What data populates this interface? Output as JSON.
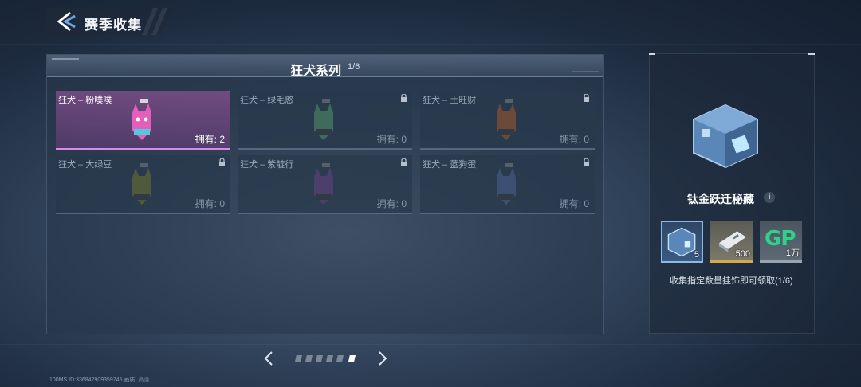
{
  "header": {
    "title": "赛季收集"
  },
  "collection": {
    "title": "狂犬系列",
    "count": "1/6",
    "items": [
      {
        "name": "狂犬 – 粉噗噗",
        "owned": "拥有: 2",
        "locked": false,
        "color": "#e35fb9"
      },
      {
        "name": "狂犬 – 绿毛憨",
        "owned": "拥有: 0",
        "locked": true,
        "color": "#3f6b5d"
      },
      {
        "name": "狂犬 – 土旺财",
        "owned": "拥有: 0",
        "locked": true,
        "color": "#6b4a3a"
      },
      {
        "name": "狂犬 – 大绿豆",
        "owned": "拥有: 0",
        "locked": true,
        "color": "#4f5a3d"
      },
      {
        "name": "狂犬 – 紫靛行",
        "owned": "拥有: 0",
        "locked": true,
        "color": "#4c3f6b"
      },
      {
        "name": "狂犬 – 蓝狗蛋",
        "owned": "拥有: 0",
        "locked": true,
        "color": "#3d4f72"
      }
    ]
  },
  "pagination": {
    "total": 6,
    "current": 6
  },
  "reward": {
    "title": "钛金跃迁秘藏",
    "info_icon": "i",
    "items": [
      {
        "icon": "chest-icon",
        "qty": "5"
      },
      {
        "icon": "ticket-icon",
        "qty": "500"
      },
      {
        "icon": "gp-icon",
        "qty": "1万",
        "label": "GP"
      }
    ],
    "desc": "收集指定数量挂饰即可领取(1/6)"
  },
  "footer": {
    "text": "100MS  ID:336842909359745   画质: 高清"
  }
}
